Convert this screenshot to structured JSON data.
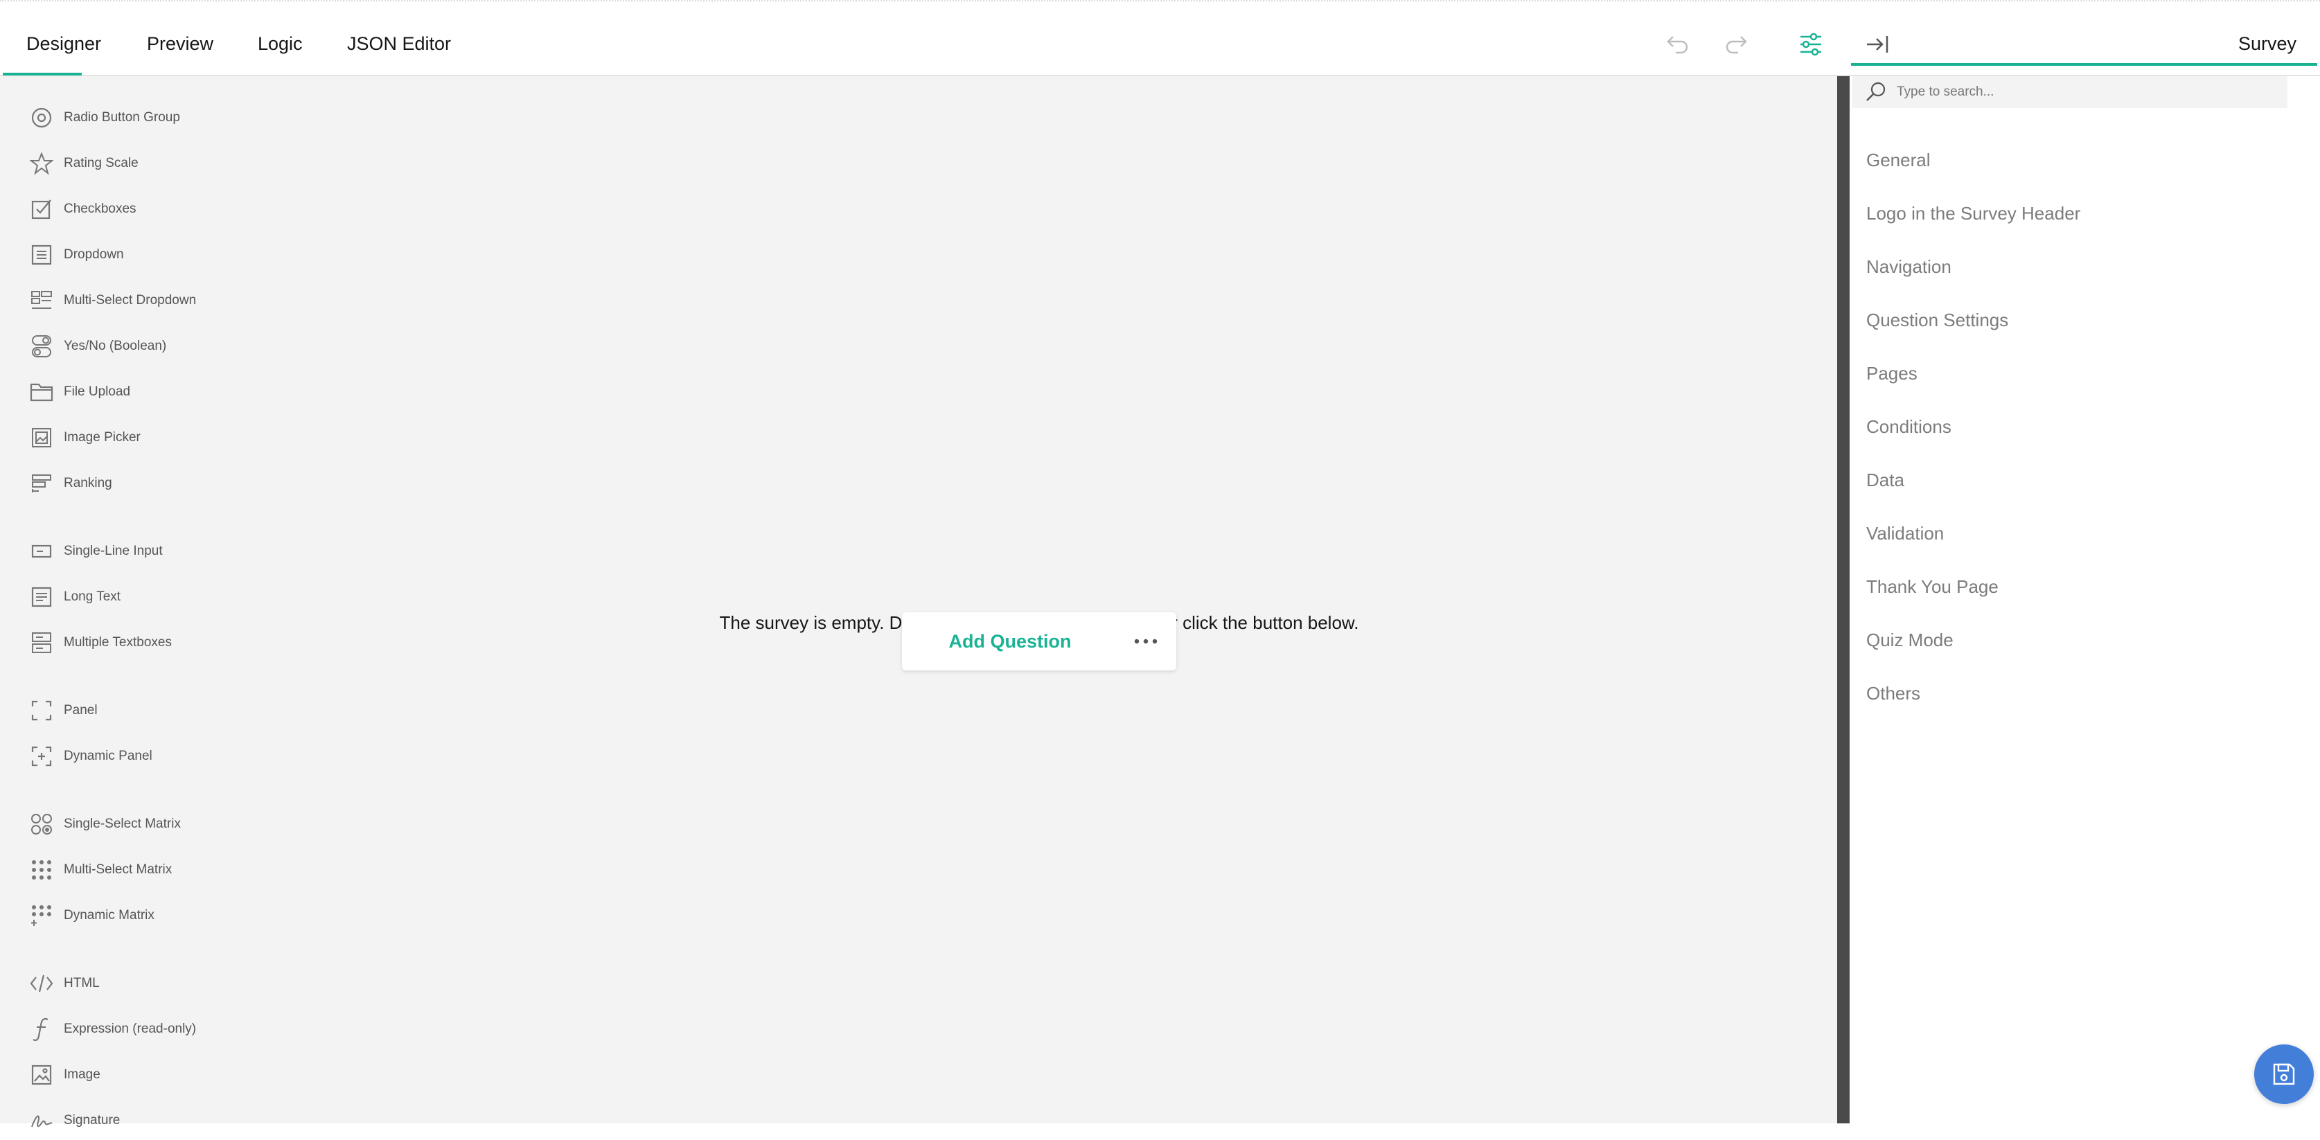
{
  "tabs": [
    {
      "label": "Designer",
      "active": true
    },
    {
      "label": "Preview"
    },
    {
      "label": "Logic"
    },
    {
      "label": "JSON Editor"
    }
  ],
  "toolbar": {
    "undo_icon": "undo-icon",
    "redo_icon": "redo-icon",
    "settings_icon": "settings-sliders-icon",
    "collapse_icon": "collapse-panel-icon",
    "survey_title": "Survey",
    "accent_color": "#19b394"
  },
  "toolbox": {
    "items": [
      {
        "label": "Radio Button Group",
        "icon": "radio-icon"
      },
      {
        "label": "Rating Scale",
        "icon": "star-icon"
      },
      {
        "label": "Checkboxes",
        "icon": "checkbox-icon"
      },
      {
        "label": "Dropdown",
        "icon": "dropdown-icon"
      },
      {
        "label": "Multi-Select Dropdown",
        "icon": "multi-dropdown-icon"
      },
      {
        "label": "Yes/No (Boolean)",
        "icon": "boolean-icon"
      },
      {
        "label": "File Upload",
        "icon": "folder-icon"
      },
      {
        "label": "Image Picker",
        "icon": "image-picker-icon"
      },
      {
        "label": "Ranking",
        "icon": "ranking-icon"
      },
      {
        "label": "Single-Line Input",
        "icon": "text-input-icon"
      },
      {
        "label": "Long Text",
        "icon": "long-text-icon"
      },
      {
        "label": "Multiple Textboxes",
        "icon": "multiple-text-icon"
      },
      {
        "label": "Panel",
        "icon": "panel-icon"
      },
      {
        "label": "Dynamic Panel",
        "icon": "dynamic-panel-icon"
      },
      {
        "label": "Single-Select Matrix",
        "icon": "matrix-single-icon"
      },
      {
        "label": "Multi-Select Matrix",
        "icon": "matrix-multi-icon"
      },
      {
        "label": "Dynamic Matrix",
        "icon": "matrix-dynamic-icon"
      },
      {
        "label": "HTML",
        "icon": "code-icon"
      },
      {
        "label": "Expression (read-only)",
        "icon": "function-icon"
      },
      {
        "label": "Image",
        "icon": "image-icon"
      },
      {
        "label": "Signature",
        "icon": "signature-icon"
      }
    ]
  },
  "canvas": {
    "empty_message": "The survey is empty. Drag an element from the toolbox or click the button below.",
    "add_question_label": "Add Question",
    "more_icon": "more-dots-icon"
  },
  "properties": {
    "search_placeholder": "Type to search...",
    "categories": [
      "General",
      "Logo in the Survey Header",
      "Navigation",
      "Question Settings",
      "Pages",
      "Conditions",
      "Data",
      "Validation",
      "Thank You Page",
      "Quiz Mode",
      "Others"
    ]
  },
  "fab": {
    "icon": "save-icon",
    "color": "#437fd9"
  }
}
